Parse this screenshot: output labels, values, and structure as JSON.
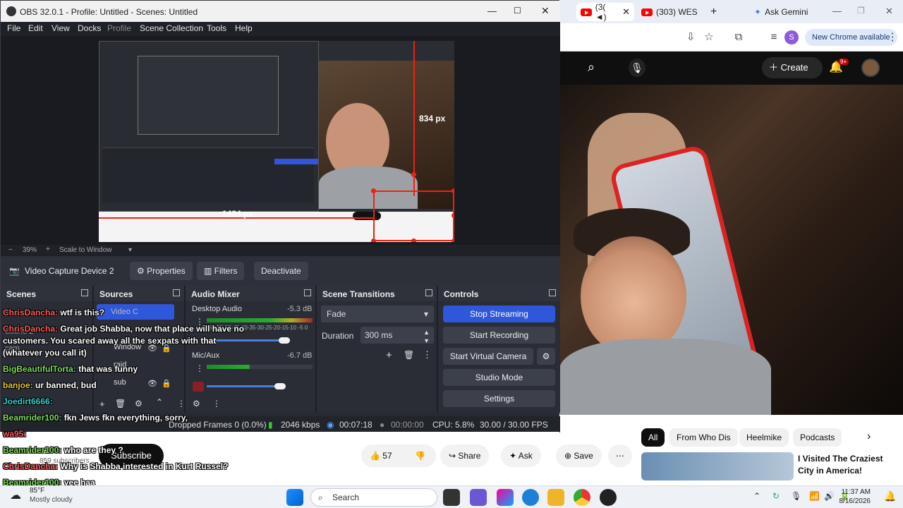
{
  "chrome": {
    "tabs": [
      {
        "label": "(3( ◄)"
      },
      {
        "label": "(303) WES"
      },
      {
        "label": "Ask Gemini"
      }
    ],
    "update_pill": "New Chrome available",
    "create_label": "Create",
    "notif_count": "9+",
    "chips": [
      "All",
      "From Who Dis",
      "Heelmike",
      "Podcasts"
    ],
    "rec_title_1": "I Visited The Craziest",
    "rec_title_2": "City in America!"
  },
  "obs": {
    "title": "OBS 32.0.1 - Profile: Untitled - Scenes: Untitled",
    "menu": [
      "File",
      "Edit",
      "View",
      "Docks",
      "Profile",
      "Scene Collection",
      "Tools",
      "Help"
    ],
    "measure_v": "834 px",
    "measure_h": "1484 px",
    "zoom": "39%",
    "scale_mode": "Scale to Window",
    "source_name": "Video Capture Device 2",
    "btn_properties": "Properties",
    "btn_filters": "Filters",
    "btn_deactivate": "Deactivate",
    "docks": {
      "scenes": "Scenes",
      "sources": "Sources",
      "mixer": "Audio Mixer",
      "transitions": "Scene Transitions",
      "controls": "Controls"
    },
    "scene_items": [
      "Scene",
      "Scene 2",
      "cam"
    ],
    "source_items": [
      "Video C",
      "Window",
      "raid",
      "sub"
    ],
    "mixer": {
      "ch1_name": "Desktop Audio",
      "ch1_db": "-5.3 dB",
      "ch2_name": "Mic/Aux",
      "ch2_db": "-6.7 dB",
      "scale": "-60-55-50-45-40-35-30-25-20-15-10 -5 0"
    },
    "transitions": {
      "type": "Fade",
      "duration_label": "Duration",
      "duration_value": "300 ms"
    },
    "controls": {
      "stop_streaming": "Stop Streaming",
      "start_recording": "Start Recording",
      "start_virtual_camera": "Start Virtual Camera",
      "studio_mode": "Studio Mode",
      "settings": "Settings"
    },
    "status": {
      "dropped": "Dropped Frames 0 (0.0%)",
      "bitrate": "2046 kbps",
      "stream_time": "00:07:18",
      "rec_time": "00:00:00",
      "cpu": "CPU: 5.8%",
      "fps": "30.00 / 30.00 FPS"
    }
  },
  "chat": [
    {
      "user": "ChrisDancha:",
      "msg": " wtf is this?"
    },
    {
      "user": "ChrisDancha:",
      "msg": " Great job Shabba, now that place will have no"
    },
    {
      "user": "",
      "msg": "customers. You scared away all the sexpats with that"
    },
    {
      "user": "",
      "msg": "(whatever you call it)"
    },
    {
      "user": "BigBeautifulTorta:",
      "msg": " that was funny"
    },
    {
      "user": "banjoe:",
      "msg": " ur banned, bud"
    },
    {
      "user": "Joedirt6666:",
      "msg": ""
    },
    {
      "user": "Beamrider100:",
      "msg": " fkn Jews fkn everything, sorry,"
    },
    {
      "user": "wa95:",
      "msg": ""
    },
    {
      "user": "Beamrider100:",
      "msg": " who are they ?"
    },
    {
      "user": "ChrisDancha:",
      "msg": " Why is Shabba interested in Kurt Russel?"
    },
    {
      "user": "Beamrider100:",
      "msg": " yee haa"
    }
  ],
  "youtube": {
    "likes": "57",
    "share": "Share",
    "ask": "Ask",
    "save": "Save",
    "subscribe": "Subscribe",
    "subscribers": "859 subscribers"
  },
  "taskbar": {
    "weather_temp": "85°F",
    "weather_desc": "Mostly cloudy",
    "search": "Search",
    "time": "11:37 AM",
    "date": "8/16/2026"
  }
}
